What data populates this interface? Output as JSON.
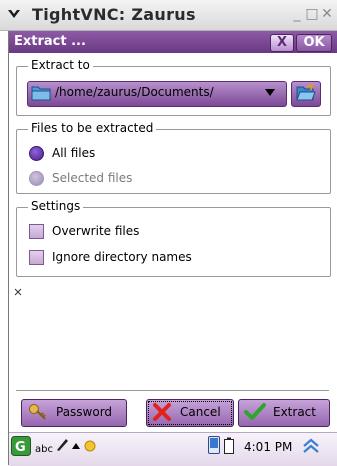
{
  "window": {
    "title": "TightVNC: Zaurus",
    "minimize_glyph": "_",
    "maximize_glyph": "□",
    "close_glyph": "✕"
  },
  "dialog": {
    "title": "Extract ...",
    "close_label": "X",
    "ok_label": "OK"
  },
  "extract_to": {
    "legend": "Extract to",
    "path": "/home/zaurus/Documents/",
    "path_icon": "folder-icon",
    "browse_icon": "folder-open-icon"
  },
  "files": {
    "legend": "Files to be extracted",
    "options": [
      {
        "label": "All files",
        "selected": true
      },
      {
        "label": "Selected files",
        "selected": false
      }
    ]
  },
  "settings": {
    "legend": "Settings",
    "options": [
      {
        "label": "Overwrite files",
        "checked": false
      },
      {
        "label": "Ignore directory names",
        "checked": false
      }
    ]
  },
  "buttons": {
    "password": "Password",
    "cancel": "Cancel",
    "extract": "Extract"
  },
  "taskbar": {
    "input_mode": "abc",
    "clock": "4:01 PM"
  },
  "colors": {
    "accent": "#7b4896",
    "title_bar": "#6a3983",
    "radio_selected": "#5b2b9c"
  }
}
